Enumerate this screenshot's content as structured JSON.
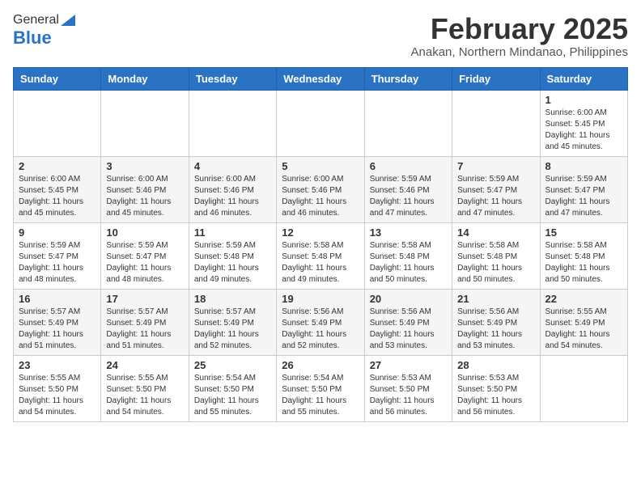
{
  "header": {
    "logo_general": "General",
    "logo_blue": "Blue",
    "month_year": "February 2025",
    "location": "Anakan, Northern Mindanao, Philippines"
  },
  "weekdays": [
    "Sunday",
    "Monday",
    "Tuesday",
    "Wednesday",
    "Thursday",
    "Friday",
    "Saturday"
  ],
  "weeks": [
    [
      null,
      null,
      null,
      null,
      null,
      null,
      {
        "day": 1,
        "sunrise": "6:00 AM",
        "sunset": "5:45 PM",
        "daylight": "11 hours and 45 minutes."
      }
    ],
    [
      {
        "day": 2,
        "sunrise": "6:00 AM",
        "sunset": "5:45 PM",
        "daylight": "11 hours and 45 minutes."
      },
      {
        "day": 3,
        "sunrise": "6:00 AM",
        "sunset": "5:46 PM",
        "daylight": "11 hours and 45 minutes."
      },
      {
        "day": 4,
        "sunrise": "6:00 AM",
        "sunset": "5:46 PM",
        "daylight": "11 hours and 46 minutes."
      },
      {
        "day": 5,
        "sunrise": "6:00 AM",
        "sunset": "5:46 PM",
        "daylight": "11 hours and 46 minutes."
      },
      {
        "day": 6,
        "sunrise": "5:59 AM",
        "sunset": "5:46 PM",
        "daylight": "11 hours and 47 minutes."
      },
      {
        "day": 7,
        "sunrise": "5:59 AM",
        "sunset": "5:47 PM",
        "daylight": "11 hours and 47 minutes."
      },
      {
        "day": 8,
        "sunrise": "5:59 AM",
        "sunset": "5:47 PM",
        "daylight": "11 hours and 47 minutes."
      }
    ],
    [
      {
        "day": 9,
        "sunrise": "5:59 AM",
        "sunset": "5:47 PM",
        "daylight": "11 hours and 48 minutes."
      },
      {
        "day": 10,
        "sunrise": "5:59 AM",
        "sunset": "5:47 PM",
        "daylight": "11 hours and 48 minutes."
      },
      {
        "day": 11,
        "sunrise": "5:59 AM",
        "sunset": "5:48 PM",
        "daylight": "11 hours and 49 minutes."
      },
      {
        "day": 12,
        "sunrise": "5:58 AM",
        "sunset": "5:48 PM",
        "daylight": "11 hours and 49 minutes."
      },
      {
        "day": 13,
        "sunrise": "5:58 AM",
        "sunset": "5:48 PM",
        "daylight": "11 hours and 50 minutes."
      },
      {
        "day": 14,
        "sunrise": "5:58 AM",
        "sunset": "5:48 PM",
        "daylight": "11 hours and 50 minutes."
      },
      {
        "day": 15,
        "sunrise": "5:58 AM",
        "sunset": "5:48 PM",
        "daylight": "11 hours and 50 minutes."
      }
    ],
    [
      {
        "day": 16,
        "sunrise": "5:57 AM",
        "sunset": "5:49 PM",
        "daylight": "11 hours and 51 minutes."
      },
      {
        "day": 17,
        "sunrise": "5:57 AM",
        "sunset": "5:49 PM",
        "daylight": "11 hours and 51 minutes."
      },
      {
        "day": 18,
        "sunrise": "5:57 AM",
        "sunset": "5:49 PM",
        "daylight": "11 hours and 52 minutes."
      },
      {
        "day": 19,
        "sunrise": "5:56 AM",
        "sunset": "5:49 PM",
        "daylight": "11 hours and 52 minutes."
      },
      {
        "day": 20,
        "sunrise": "5:56 AM",
        "sunset": "5:49 PM",
        "daylight": "11 hours and 53 minutes."
      },
      {
        "day": 21,
        "sunrise": "5:56 AM",
        "sunset": "5:49 PM",
        "daylight": "11 hours and 53 minutes."
      },
      {
        "day": 22,
        "sunrise": "5:55 AM",
        "sunset": "5:49 PM",
        "daylight": "11 hours and 54 minutes."
      }
    ],
    [
      {
        "day": 23,
        "sunrise": "5:55 AM",
        "sunset": "5:50 PM",
        "daylight": "11 hours and 54 minutes."
      },
      {
        "day": 24,
        "sunrise": "5:55 AM",
        "sunset": "5:50 PM",
        "daylight": "11 hours and 54 minutes."
      },
      {
        "day": 25,
        "sunrise": "5:54 AM",
        "sunset": "5:50 PM",
        "daylight": "11 hours and 55 minutes."
      },
      {
        "day": 26,
        "sunrise": "5:54 AM",
        "sunset": "5:50 PM",
        "daylight": "11 hours and 55 minutes."
      },
      {
        "day": 27,
        "sunrise": "5:53 AM",
        "sunset": "5:50 PM",
        "daylight": "11 hours and 56 minutes."
      },
      {
        "day": 28,
        "sunrise": "5:53 AM",
        "sunset": "5:50 PM",
        "daylight": "11 hours and 56 minutes."
      },
      null
    ]
  ]
}
